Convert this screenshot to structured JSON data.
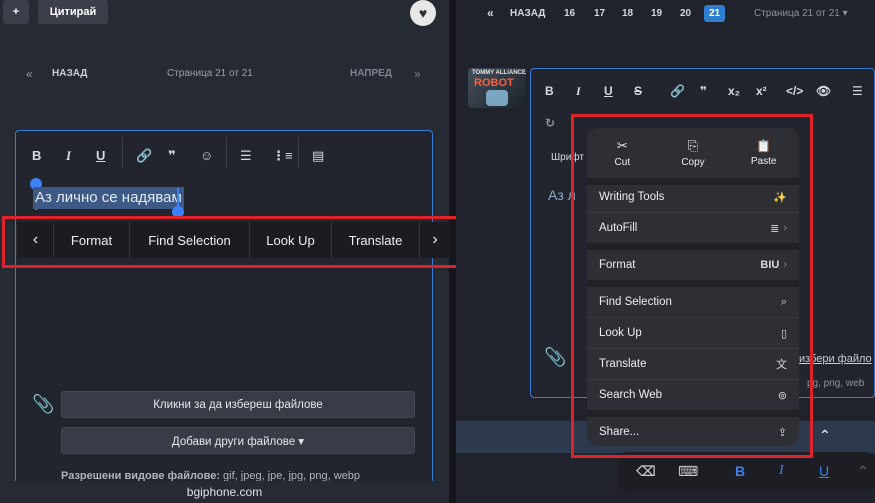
{
  "left": {
    "plus": "+",
    "quote": "Цитирай",
    "heart_icon": "heart-icon",
    "back_arrow": "«",
    "back": "НАЗАД",
    "page_info": "Страница 21 от 21",
    "next": "НАПРЕД",
    "next_arrow": "»",
    "toolbar": [
      "B",
      "I",
      "U",
      "🔗",
      "❞",
      "☺",
      "☰",
      "⋮≡",
      "▤"
    ],
    "selected_text": "Аз лично се надявам",
    "context_menu": {
      "prev": "‹",
      "items": [
        "Format",
        "Find Selection",
        "Look Up",
        "Translate"
      ],
      "next": "›"
    },
    "choose_files": "Кликни за да избереш файлове",
    "add_files": "Добави други файлове ▾",
    "allowed_label": "Разрешени видове файлове:",
    "allowed_types": "gif, jpeg, jpe, jpg, png, webp",
    "footer": "bgiphone.com"
  },
  "right": {
    "back_arrow": "«",
    "back": "НАЗАД",
    "pages": [
      "16",
      "17",
      "18",
      "19",
      "20",
      "21"
    ],
    "active_page": "21",
    "page_select": "Страница 21 от 21 ▾",
    "thumb_text_1": "TOMMY ALLIANCE",
    "thumb_text_2": "ROBOT",
    "toolbar": [
      "B",
      "I",
      "U",
      "S",
      "🔗",
      "❞",
      "x₂",
      "x²",
      "</>",
      "👁",
      "☰"
    ],
    "font_label": "Шрифт",
    "editor_text": "Аз л",
    "right_link": "избери файло",
    "right_types": "pg, png, web",
    "popup": {
      "top": [
        {
          "icon": "✂",
          "label": "Cut"
        },
        {
          "icon": "⎘",
          "label": "Copy"
        },
        {
          "icon": "📋",
          "label": "Paste"
        }
      ],
      "items": [
        {
          "label": "Writing Tools",
          "icon": "✨"
        },
        {
          "label": "AutoFill",
          "icon": "≣",
          "arrow": "›"
        },
        {
          "label": "Format",
          "icon": "BIU",
          "arrow": "›"
        },
        {
          "label": "Find Selection",
          "icon": "⌕"
        },
        {
          "label": "Look Up",
          "icon": "▯"
        },
        {
          "label": "Translate",
          "icon": "文"
        },
        {
          "label": "Search Web",
          "icon": "⊚"
        },
        {
          "label": "Share...",
          "icon": "⇪"
        }
      ]
    },
    "chevron_up": "⌃",
    "keyboard": [
      "⌫",
      "⌨",
      "B",
      "I",
      "U",
      "⌃"
    ]
  },
  "colors": {
    "accent": "#3c82f6",
    "highlight_red": "#e0232a",
    "editor_border": "#3a7bd5"
  }
}
